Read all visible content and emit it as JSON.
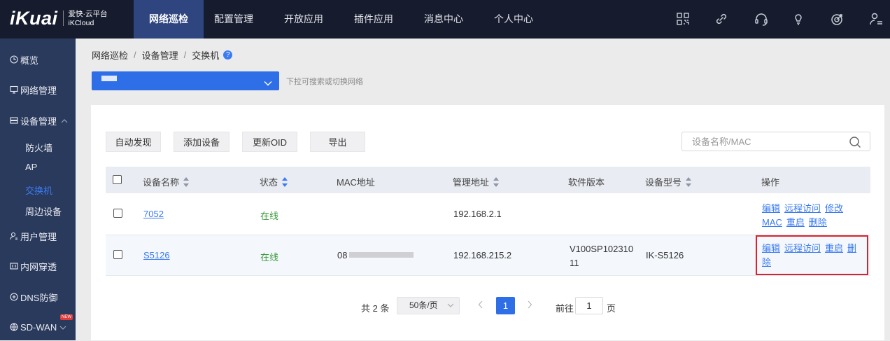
{
  "brand": {
    "logo": "iKuai",
    "sub1": "爱快·云平台",
    "sub2": "iKCloud"
  },
  "topnav": [
    {
      "label": "网络巡检",
      "active": true
    },
    {
      "label": "配置管理"
    },
    {
      "label": "开放应用"
    },
    {
      "label": "插件应用"
    },
    {
      "label": "消息中心"
    },
    {
      "label": "个人中心"
    }
  ],
  "top_icons": [
    "qrcode-icon",
    "link-icon",
    "headset-icon",
    "lightbulb-icon",
    "target-icon",
    "user-settings-icon"
  ],
  "sidebar": {
    "items": [
      {
        "label": "概览",
        "icon": "clock-icon"
      },
      {
        "label": "网络管理",
        "icon": "monitor-icon"
      },
      {
        "label": "设备管理",
        "icon": "device-icon",
        "expanded": true
      },
      {
        "label": "用户管理",
        "icon": "user-icon"
      },
      {
        "label": "内网穿透",
        "icon": "tunnel-icon"
      },
      {
        "label": "DNS防御",
        "icon": "shield-icon"
      },
      {
        "label": "SD-WAN",
        "icon": "globe-icon",
        "badge": "NEW"
      }
    ],
    "sub_items": [
      "防火墙",
      "AP",
      "交换机",
      "周边设备"
    ],
    "active_sub": "交换机"
  },
  "breadcrumb": [
    "网络巡检",
    "设备管理",
    "交换机"
  ],
  "network_select": {
    "hint": "下拉可搜索或切换网络"
  },
  "toolbar": {
    "auto_discover": "自动发现",
    "add_device": "添加设备",
    "update_oid": "更新OID",
    "export": "导出",
    "search_placeholder": "设备名称/MAC"
  },
  "table": {
    "headers": {
      "name": "设备名称",
      "status": "状态",
      "mac": "MAC地址",
      "mgmt": "管理地址",
      "version": "软件版本",
      "model": "设备型号",
      "ops": "操作"
    },
    "rows": [
      {
        "name": "7052",
        "status": "在线",
        "mac": "",
        "mgmt": "192.168.2.1",
        "version": "",
        "model": "",
        "ops": [
          "编辑",
          "远程访问",
          "修改MAC",
          "重启",
          "删除"
        ]
      },
      {
        "name": "S5126",
        "status": "在线",
        "mac": "08",
        "mgmt": "192.168.215.2",
        "version": "V100SP10231011",
        "model": "IK-S5126",
        "ops": [
          "编辑",
          "远程访问",
          "重启",
          "删除"
        ]
      }
    ]
  },
  "pager": {
    "total": "共 2 条",
    "size": "50条/页",
    "current": "1",
    "goto_label": "前往",
    "goto_value": "1",
    "page_unit": "页"
  },
  "colors": {
    "topbar": "#161c2e",
    "sidebar": "#2a3a5c",
    "accent": "#3a7bf4",
    "online": "#3a9b3a",
    "highlight": "#d9232c"
  }
}
